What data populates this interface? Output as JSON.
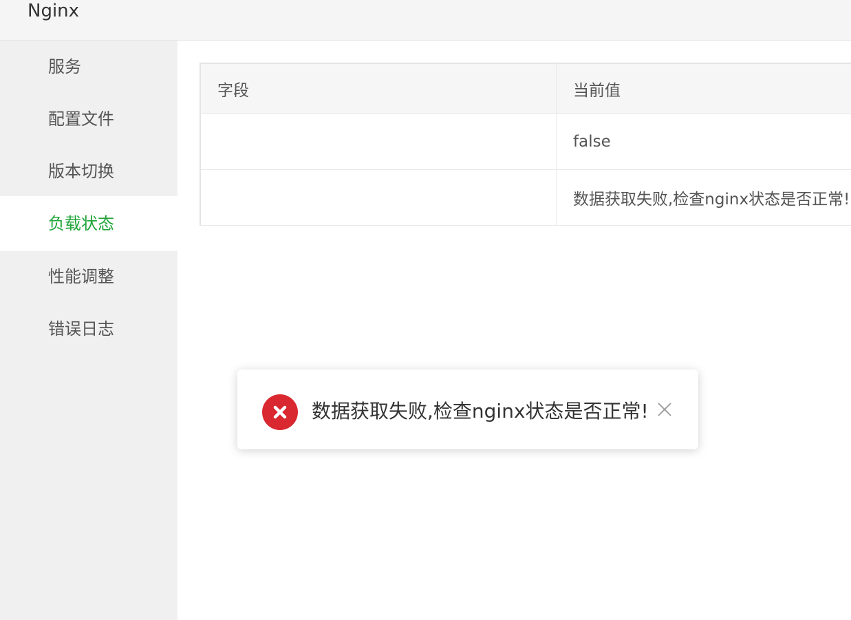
{
  "app": {
    "title": "Nginx"
  },
  "sidebar": {
    "items": [
      {
        "label": "服务"
      },
      {
        "label": "配置文件"
      },
      {
        "label": "版本切换"
      },
      {
        "label": "负载状态",
        "active": true
      },
      {
        "label": "性能调整"
      },
      {
        "label": "错误日志"
      }
    ]
  },
  "table": {
    "headers": [
      "字段",
      "当前值"
    ],
    "rows": [
      [
        "",
        "false"
      ],
      [
        "",
        "数据获取失败,检查nginx状态是否正常!"
      ]
    ]
  },
  "toast": {
    "message": "数据获取失败,检查nginx状态是否正常!",
    "icon": "error-icon",
    "close_icon": "close-icon"
  },
  "colors": {
    "accent": "#20a53a",
    "error": "#d9282f",
    "sidebar_bg": "#f0f0f0",
    "header_bg": "#f5f5f5"
  }
}
